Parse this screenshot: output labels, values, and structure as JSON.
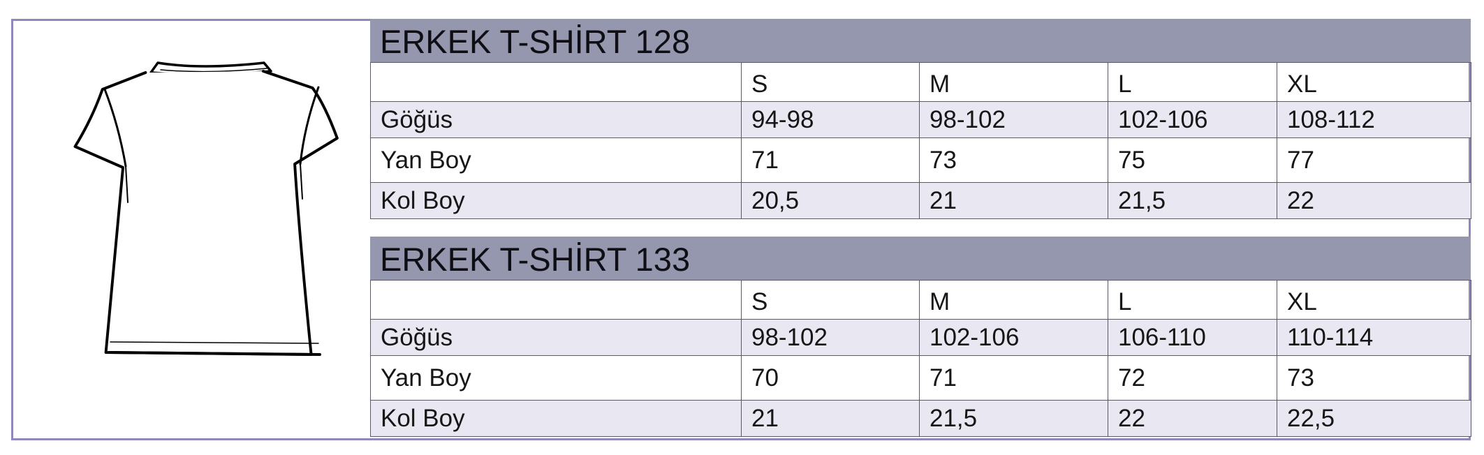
{
  "tables": [
    {
      "title": "ERKEK T-SHİRT 128",
      "sizes": [
        "S",
        "M",
        "L",
        "XL"
      ],
      "rows": [
        {
          "label": "Göğüs",
          "values": [
            "94-98",
            "98-102",
            "102-106",
            "108-112"
          ]
        },
        {
          "label": "Yan Boy",
          "values": [
            "71",
            "73",
            "75",
            "77"
          ]
        },
        {
          "label": "Kol Boy",
          "values": [
            "20,5",
            "21",
            "21,5",
            "22"
          ]
        }
      ]
    },
    {
      "title": "ERKEK T-SHİRT 133",
      "sizes": [
        "S",
        "M",
        "L",
        "XL"
      ],
      "rows": [
        {
          "label": "Göğüs",
          "values": [
            "98-102",
            "102-106",
            "106-110",
            "110-114"
          ]
        },
        {
          "label": "Yan Boy",
          "values": [
            "70",
            "71",
            "72",
            "73"
          ]
        },
        {
          "label": "Kol Boy",
          "values": [
            "21",
            "21,5",
            "22",
            "22,5"
          ]
        }
      ]
    }
  ],
  "colors": {
    "frame_border": "#8f88bd",
    "title_band": "#9497ad",
    "row_shade": "#e9e8f2"
  },
  "icons": {
    "shirt": "t-shirt-line-drawing"
  }
}
